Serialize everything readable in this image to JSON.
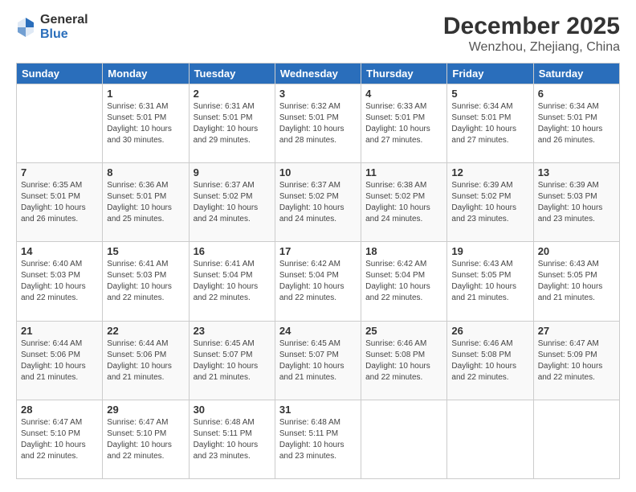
{
  "header": {
    "logo_general": "General",
    "logo_blue": "Blue",
    "month_year": "December 2025",
    "location": "Wenzhou, Zhejiang, China"
  },
  "days_of_week": [
    "Sunday",
    "Monday",
    "Tuesday",
    "Wednesday",
    "Thursday",
    "Friday",
    "Saturday"
  ],
  "weeks": [
    [
      {
        "day": "",
        "info": ""
      },
      {
        "day": "1",
        "info": "Sunrise: 6:31 AM\nSunset: 5:01 PM\nDaylight: 10 hours\nand 30 minutes."
      },
      {
        "day": "2",
        "info": "Sunrise: 6:31 AM\nSunset: 5:01 PM\nDaylight: 10 hours\nand 29 minutes."
      },
      {
        "day": "3",
        "info": "Sunrise: 6:32 AM\nSunset: 5:01 PM\nDaylight: 10 hours\nand 28 minutes."
      },
      {
        "day": "4",
        "info": "Sunrise: 6:33 AM\nSunset: 5:01 PM\nDaylight: 10 hours\nand 27 minutes."
      },
      {
        "day": "5",
        "info": "Sunrise: 6:34 AM\nSunset: 5:01 PM\nDaylight: 10 hours\nand 27 minutes."
      },
      {
        "day": "6",
        "info": "Sunrise: 6:34 AM\nSunset: 5:01 PM\nDaylight: 10 hours\nand 26 minutes."
      }
    ],
    [
      {
        "day": "7",
        "info": "Sunrise: 6:35 AM\nSunset: 5:01 PM\nDaylight: 10 hours\nand 26 minutes."
      },
      {
        "day": "8",
        "info": "Sunrise: 6:36 AM\nSunset: 5:01 PM\nDaylight: 10 hours\nand 25 minutes."
      },
      {
        "day": "9",
        "info": "Sunrise: 6:37 AM\nSunset: 5:02 PM\nDaylight: 10 hours\nand 24 minutes."
      },
      {
        "day": "10",
        "info": "Sunrise: 6:37 AM\nSunset: 5:02 PM\nDaylight: 10 hours\nand 24 minutes."
      },
      {
        "day": "11",
        "info": "Sunrise: 6:38 AM\nSunset: 5:02 PM\nDaylight: 10 hours\nand 24 minutes."
      },
      {
        "day": "12",
        "info": "Sunrise: 6:39 AM\nSunset: 5:02 PM\nDaylight: 10 hours\nand 23 minutes."
      },
      {
        "day": "13",
        "info": "Sunrise: 6:39 AM\nSunset: 5:03 PM\nDaylight: 10 hours\nand 23 minutes."
      }
    ],
    [
      {
        "day": "14",
        "info": "Sunrise: 6:40 AM\nSunset: 5:03 PM\nDaylight: 10 hours\nand 22 minutes."
      },
      {
        "day": "15",
        "info": "Sunrise: 6:41 AM\nSunset: 5:03 PM\nDaylight: 10 hours\nand 22 minutes."
      },
      {
        "day": "16",
        "info": "Sunrise: 6:41 AM\nSunset: 5:04 PM\nDaylight: 10 hours\nand 22 minutes."
      },
      {
        "day": "17",
        "info": "Sunrise: 6:42 AM\nSunset: 5:04 PM\nDaylight: 10 hours\nand 22 minutes."
      },
      {
        "day": "18",
        "info": "Sunrise: 6:42 AM\nSunset: 5:04 PM\nDaylight: 10 hours\nand 22 minutes."
      },
      {
        "day": "19",
        "info": "Sunrise: 6:43 AM\nSunset: 5:05 PM\nDaylight: 10 hours\nand 21 minutes."
      },
      {
        "day": "20",
        "info": "Sunrise: 6:43 AM\nSunset: 5:05 PM\nDaylight: 10 hours\nand 21 minutes."
      }
    ],
    [
      {
        "day": "21",
        "info": "Sunrise: 6:44 AM\nSunset: 5:06 PM\nDaylight: 10 hours\nand 21 minutes."
      },
      {
        "day": "22",
        "info": "Sunrise: 6:44 AM\nSunset: 5:06 PM\nDaylight: 10 hours\nand 21 minutes."
      },
      {
        "day": "23",
        "info": "Sunrise: 6:45 AM\nSunset: 5:07 PM\nDaylight: 10 hours\nand 21 minutes."
      },
      {
        "day": "24",
        "info": "Sunrise: 6:45 AM\nSunset: 5:07 PM\nDaylight: 10 hours\nand 21 minutes."
      },
      {
        "day": "25",
        "info": "Sunrise: 6:46 AM\nSunset: 5:08 PM\nDaylight: 10 hours\nand 22 minutes."
      },
      {
        "day": "26",
        "info": "Sunrise: 6:46 AM\nSunset: 5:08 PM\nDaylight: 10 hours\nand 22 minutes."
      },
      {
        "day": "27",
        "info": "Sunrise: 6:47 AM\nSunset: 5:09 PM\nDaylight: 10 hours\nand 22 minutes."
      }
    ],
    [
      {
        "day": "28",
        "info": "Sunrise: 6:47 AM\nSunset: 5:10 PM\nDaylight: 10 hours\nand 22 minutes."
      },
      {
        "day": "29",
        "info": "Sunrise: 6:47 AM\nSunset: 5:10 PM\nDaylight: 10 hours\nand 22 minutes."
      },
      {
        "day": "30",
        "info": "Sunrise: 6:48 AM\nSunset: 5:11 PM\nDaylight: 10 hours\nand 23 minutes."
      },
      {
        "day": "31",
        "info": "Sunrise: 6:48 AM\nSunset: 5:11 PM\nDaylight: 10 hours\nand 23 minutes."
      },
      {
        "day": "",
        "info": ""
      },
      {
        "day": "",
        "info": ""
      },
      {
        "day": "",
        "info": ""
      }
    ]
  ]
}
